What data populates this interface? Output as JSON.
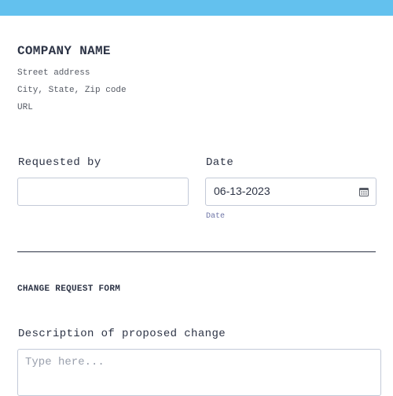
{
  "header": {
    "company_name": "COMPANY NAME",
    "street": "Street address",
    "city": "City, State, Zip code",
    "url": "URL"
  },
  "fields": {
    "requested_by_label": "Requested by",
    "requested_by_value": "",
    "date_label": "Date",
    "date_value": "06-13-2023",
    "date_sublabel": "Date"
  },
  "section": {
    "title": "CHANGE REQUEST FORM",
    "description_label": "Description of proposed change",
    "description_placeholder": "Type here..."
  },
  "colors": {
    "top_bar": "#63c1ee",
    "text": "#2c3345",
    "border": "#c3cad8"
  },
  "icons": {
    "date_picker": "calendar-icon"
  }
}
